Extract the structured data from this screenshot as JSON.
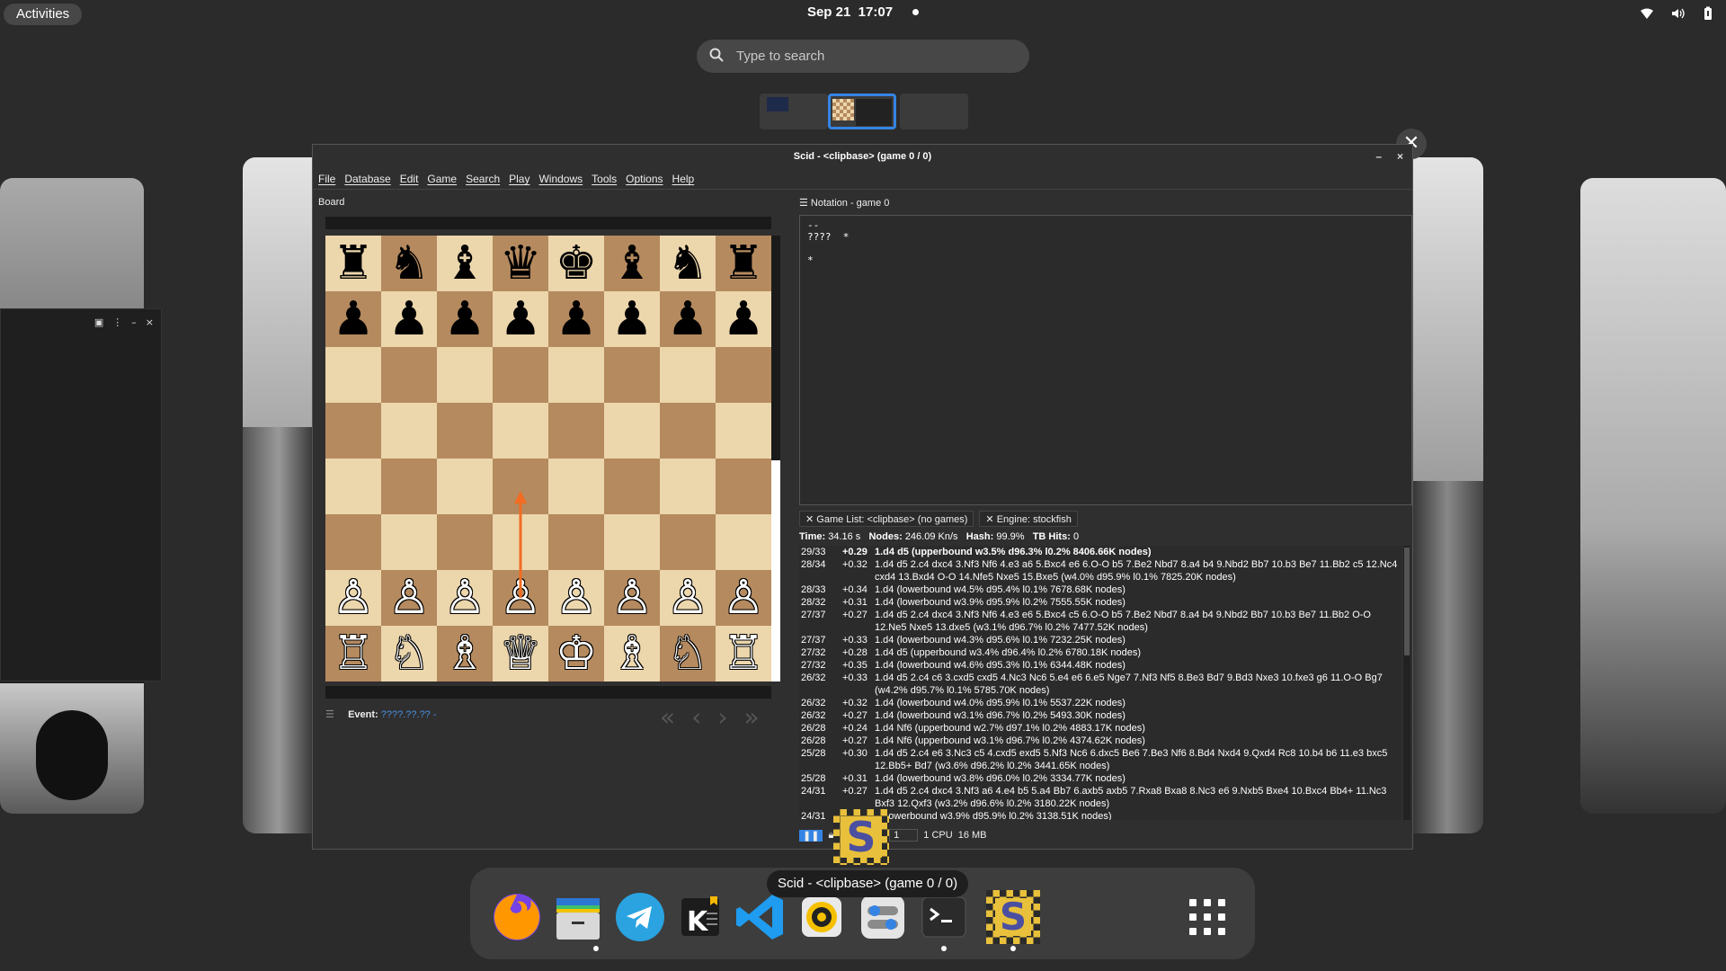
{
  "topbar": {
    "activities": "Activities",
    "date": "Sep 21",
    "time": "17:07"
  },
  "search": {
    "placeholder": "Type to search"
  },
  "window": {
    "title": "Scid - <clipbase> (game 0 / 0)",
    "menu": [
      "File",
      "Database",
      "Edit",
      "Game",
      "Search",
      "Play",
      "Windows",
      "Tools",
      "Options",
      "Help"
    ],
    "board_label": "Board",
    "event_label": "Event:",
    "event_value": "????.??.?? -",
    "notation_tab": "Notation - game 0",
    "notation_text": "--\n????  *\n\n*",
    "tabs": [
      "Game List: <clipbase> (no games)",
      "Engine: stockfish"
    ],
    "engine": {
      "time_label": "Time:",
      "time": "34.16 s",
      "nodes_label": "Nodes:",
      "nodes": "246.09 Kn/s",
      "hash_label": "Hash:",
      "hash": "99.9%",
      "tb_label": "TB Hits:",
      "tb": "0"
    },
    "pv_lines": [
      {
        "depth": "29/33",
        "score": "+0.29",
        "line": "1.d4 d5  (upperbound  w3.5%  d96.3%  l0.2%  8406.66K nodes)"
      },
      {
        "depth": "28/34",
        "score": "+0.32",
        "line": "1.d4 d5 2.c4 dxc4 3.Nf3 Nf6 4.e3 a6 5.Bxc4 e6 6.O-O b5 7.Be2 Nbd7 8.a4 b4 9.Nbd2 Bb7 10.b3 Be7 11.Bb2 c5 12.Nc4 cxd4 13.Bxd4 O-O 14.Nfe5 Nxe5 15.Bxe5  (w4.0%  d95.9%  l0.1%  7825.20K nodes)"
      },
      {
        "depth": "28/33",
        "score": "+0.34",
        "line": "1.d4  (lowerbound  w4.5%  d95.4%  l0.1%  7678.68K nodes)"
      },
      {
        "depth": "28/32",
        "score": "+0.31",
        "line": "1.d4  (lowerbound  w3.9%  d95.9%  l0.2%  7555.55K nodes)"
      },
      {
        "depth": "27/37",
        "score": "+0.27",
        "line": "1.d4 d5 2.c4 dxc4 3.Nf3 Nf6 4.e3 e6 5.Bxc4 c5 6.O-O b5 7.Be2 Nbd7 8.a4 b4 9.Nbd2 Bb7 10.b3 Be7 11.Bb2 O-O 12.Ne5 Nxe5 13.dxe5  (w3.1%  d96.7%  l0.2%  7477.52K nodes)"
      },
      {
        "depth": "27/37",
        "score": "+0.33",
        "line": "1.d4  (lowerbound  w4.3%  d95.6%  l0.1%  7232.25K nodes)"
      },
      {
        "depth": "27/32",
        "score": "+0.28",
        "line": "1.d4 d5  (upperbound  w3.4%  d96.4%  l0.2%  6780.18K nodes)"
      },
      {
        "depth": "27/32",
        "score": "+0.35",
        "line": "1.d4  (lowerbound  w4.6%  d95.3%  l0.1%  6344.48K nodes)"
      },
      {
        "depth": "26/32",
        "score": "+0.33",
        "line": "1.d4 d5 2.c4 c6 3.cxd5 cxd5 4.Nc3 Nc6 5.e4 e6 6.e5 Nge7 7.Nf3 Nf5 8.Be3 Bd7 9.Bd3 Nxe3 10.fxe3 g6 11.O-O Bg7  (w4.2%  d95.7%  l0.1%  5785.70K nodes)"
      },
      {
        "depth": "26/32",
        "score": "+0.32",
        "line": "1.d4  (lowerbound  w4.0%  d95.9%  l0.1%  5537.22K nodes)"
      },
      {
        "depth": "26/32",
        "score": "+0.27",
        "line": "1.d4  (lowerbound  w3.1%  d96.7%  l0.2%  5493.30K nodes)"
      },
      {
        "depth": "26/28",
        "score": "+0.24",
        "line": "1.d4 Nf6  (upperbound  w2.7%  d97.1%  l0.2%  4883.17K nodes)"
      },
      {
        "depth": "26/28",
        "score": "+0.27",
        "line": "1.d4 Nf6  (upperbound  w3.1%  d96.7%  l0.2%  4374.62K nodes)"
      },
      {
        "depth": "25/28",
        "score": "+0.30",
        "line": "1.d4 d5 2.c4 e6 3.Nc3 c5 4.cxd5 exd5 5.Nf3 Nc6 6.dxc5 Be6 7.Be3 Nf6 8.Bd4 Nxd4 9.Qxd4 Rc8 10.b4 b6 11.e3 bxc5 12.Bb5+ Bd7  (w3.6%  d96.2%  l0.2%  3441.65K nodes)"
      },
      {
        "depth": "25/28",
        "score": "+0.31",
        "line": "1.d4  (lowerbound  w3.8%  d96.0%  l0.2%  3334.77K nodes)"
      },
      {
        "depth": "24/31",
        "score": "+0.27",
        "line": "1.d4 d5 2.c4 dxc4 3.Nf3 a6 4.e4 b5 5.a4 Bb7 6.axb5 axb5 7.Rxa8 Bxa8 8.Nc3 e6 9.Nxb5 Bxe4 10.Bxc4 Bb4+ 11.Nc3 Bxf3 12.Qxf3  (w3.2%  d96.6%  l0.2%  3180.22K nodes)"
      },
      {
        "depth": "24/31",
        "score": "",
        "line": "4  (lowerbound  w3.9%  d95.9%  l0.2%  3138.51K nodes)"
      }
    ],
    "status": {
      "threads": "1",
      "cpu": "1 CPU",
      "mem": "16 MB"
    }
  },
  "board": [
    [
      "♜",
      "♞",
      "♝",
      "♛",
      "♚",
      "♝",
      "♞",
      "♜"
    ],
    [
      "♟",
      "♟",
      "♟",
      "♟",
      "♟",
      "♟",
      "♟",
      "♟"
    ],
    [
      "",
      "",
      "",
      "",
      "",
      "",
      "",
      ""
    ],
    [
      "",
      "",
      "",
      "",
      "",
      "",
      "",
      ""
    ],
    [
      "",
      "",
      "",
      "",
      "",
      "",
      "",
      ""
    ],
    [
      "",
      "",
      "",
      "",
      "",
      "",
      "",
      ""
    ],
    [
      "♙",
      "♙",
      "♙",
      "♙",
      "♙",
      "♙",
      "♙",
      "♙"
    ],
    [
      "♖",
      "♘",
      "♗",
      "♕",
      "♔",
      "♗",
      "♘",
      "♖"
    ]
  ],
  "dock": {
    "tooltip": "Scid - <clipbase> (game 0 / 0)",
    "apps": [
      "firefox-icon",
      "files-icon",
      "telegram-icon",
      "kate-icon",
      "vscode-icon",
      "rhythmbox-icon",
      "settings-icon",
      "terminal-icon",
      "scid-icon",
      "app-grid-icon"
    ]
  },
  "colors": {
    "accent": "#3584e4",
    "arrow": "#f36c21",
    "light_square": "#ecd6ac",
    "dark_square": "#b58a5f"
  }
}
